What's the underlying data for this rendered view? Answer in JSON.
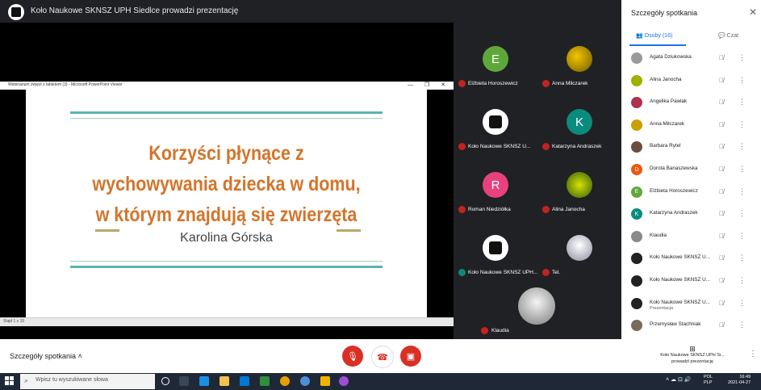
{
  "top_bar": {
    "title": "Koło Naukowe SKNSZ UPH Siedlce prowadzi prezentację"
  },
  "ppt": {
    "window_title": "Webinarium zwięzł z tabletem (3) - Microsoft PowerPoint Viewer",
    "window_controls": "— ❐ ✕",
    "slide_title_lines": [
      "Korzyści płynące z",
      "wychowywania dziecka w domu,",
      "w którym znajdują się zwierzęta"
    ],
    "slide_author": "Karolina Górska",
    "status": "Slajd 1 z 15"
  },
  "tiles": [
    {
      "initial": "E",
      "name": "Elżbieta Horoszewicz",
      "color": "#5ea83b"
    },
    {
      "initial": "",
      "name": "Anna Milczarek",
      "color": "#c9a000"
    },
    {
      "initial": "",
      "name": "Koło Naukowe SKNSZ U...",
      "color": "#ffffff"
    },
    {
      "initial": "K",
      "name": "Katarzyna Andraszek",
      "color": "#0b8a7e"
    },
    {
      "initial": "R",
      "name": "Roman Niedziółka",
      "color": "#e8417d"
    },
    {
      "initial": "",
      "name": "Alina Janocha",
      "color": "#9fb000"
    },
    {
      "initial": "",
      "name": "Koło Naukowe SKNSZ UPH...",
      "color": "#ffffff"
    },
    {
      "initial": "",
      "name": "Tel.",
      "color": "#c4c4d0"
    }
  ],
  "klaudia_tile": {
    "name": "Klaudia"
  },
  "panel": {
    "title": "Szczegóły spotkania",
    "close": "✕",
    "tab_people": "Osoby (16)",
    "tab_chat": "Czat",
    "participants": [
      {
        "initial": "",
        "name": "Agata Dziukowska",
        "sub": "",
        "color": "#9a9a9a"
      },
      {
        "initial": "",
        "name": "Alina Janocha",
        "sub": "",
        "color": "#9fb000"
      },
      {
        "initial": "",
        "name": "Angelika Pawlak",
        "sub": "",
        "color": "#b03050"
      },
      {
        "initial": "",
        "name": "Anna Milczarek",
        "sub": "",
        "color": "#c9a000"
      },
      {
        "initial": "",
        "name": "Barbara Rytel",
        "sub": "",
        "color": "#6d4c41"
      },
      {
        "initial": "D",
        "name": "Dorota Banaszewska",
        "sub": "",
        "color": "#e8590c"
      },
      {
        "initial": "E",
        "name": "Elżbieta Horoszewicz",
        "sub": "",
        "color": "#5ea83b"
      },
      {
        "initial": "K",
        "name": "Katarzyna Andraszek",
        "sub": "",
        "color": "#0b8a7e"
      },
      {
        "initial": "",
        "name": "Klaudia",
        "sub": "",
        "color": "#8a8a8a"
      },
      {
        "initial": "",
        "name": "Koło Naukowe SKNSZ U...",
        "sub": "",
        "color": "#222222"
      },
      {
        "initial": "",
        "name": "Koło Naukowe SKNSZ U...",
        "sub": "",
        "color": "#222222"
      },
      {
        "initial": "",
        "name": "Koło Naukowe SKNSZ U...",
        "sub": "Prezentacja",
        "color": "#222222"
      },
      {
        "initial": "",
        "name": "Przemysław Stachniak",
        "sub": "",
        "color": "#7a6a5a"
      }
    ]
  },
  "bottom_bar": {
    "details": "Szczegóły spotkania",
    "present_line1": "Koło Naukowe SKNSZ UPH Si...",
    "present_line2": "prowadzi prezentację"
  },
  "taskbar": {
    "search_placeholder": "Wpisz tu wyszukiwane słowa",
    "lang1": "POL",
    "lang2": "PLP",
    "time": "16:49",
    "date": "2021-04-27"
  }
}
